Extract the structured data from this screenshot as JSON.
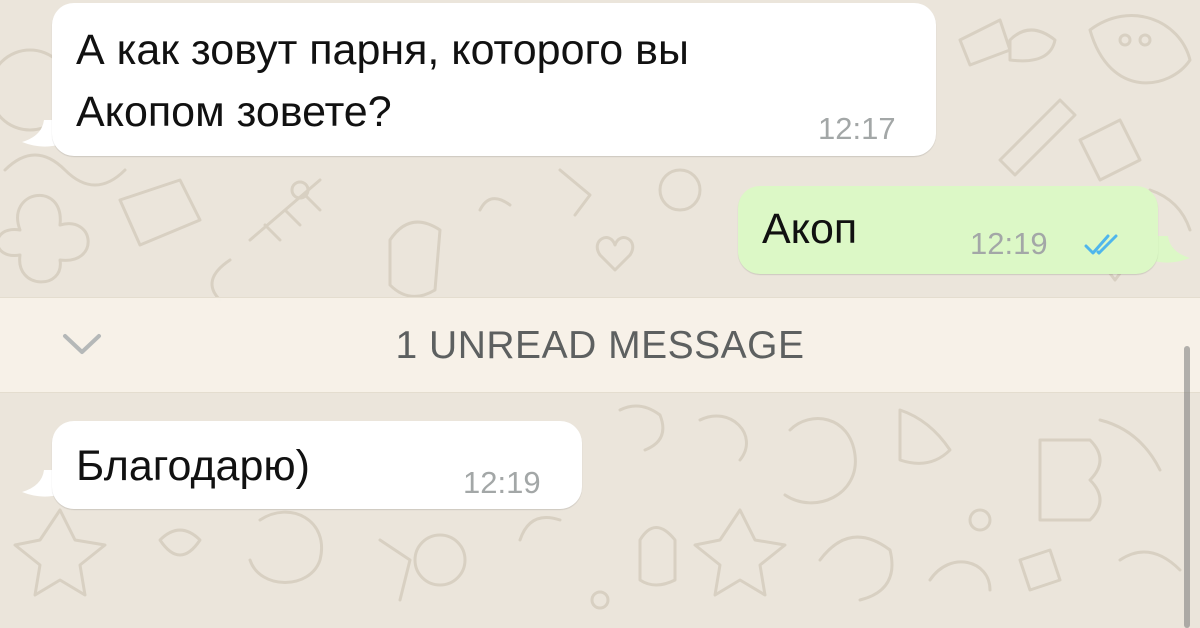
{
  "chat": {
    "messages": [
      {
        "direction": "incoming",
        "lines": [
          "А как зовут парня, которого вы",
          "Акопом зовете?"
        ],
        "time": "12:17"
      },
      {
        "direction": "outgoing",
        "lines": [
          "Акоп"
        ],
        "time": "12:19",
        "status": "read"
      },
      {
        "direction": "incoming",
        "lines": [
          "Благодарю)"
        ],
        "time": "12:19"
      }
    ],
    "unread_banner": {
      "label": "1 UNREAD MESSAGE",
      "icon": "chevron-down-icon"
    }
  },
  "colors": {
    "wallpaper": "#ebe5db",
    "incoming_bubble": "#ffffff",
    "outgoing_bubble": "#dcf8c6",
    "read_checks": "#4fb6ec",
    "timestamp": "#a3a7a7"
  }
}
